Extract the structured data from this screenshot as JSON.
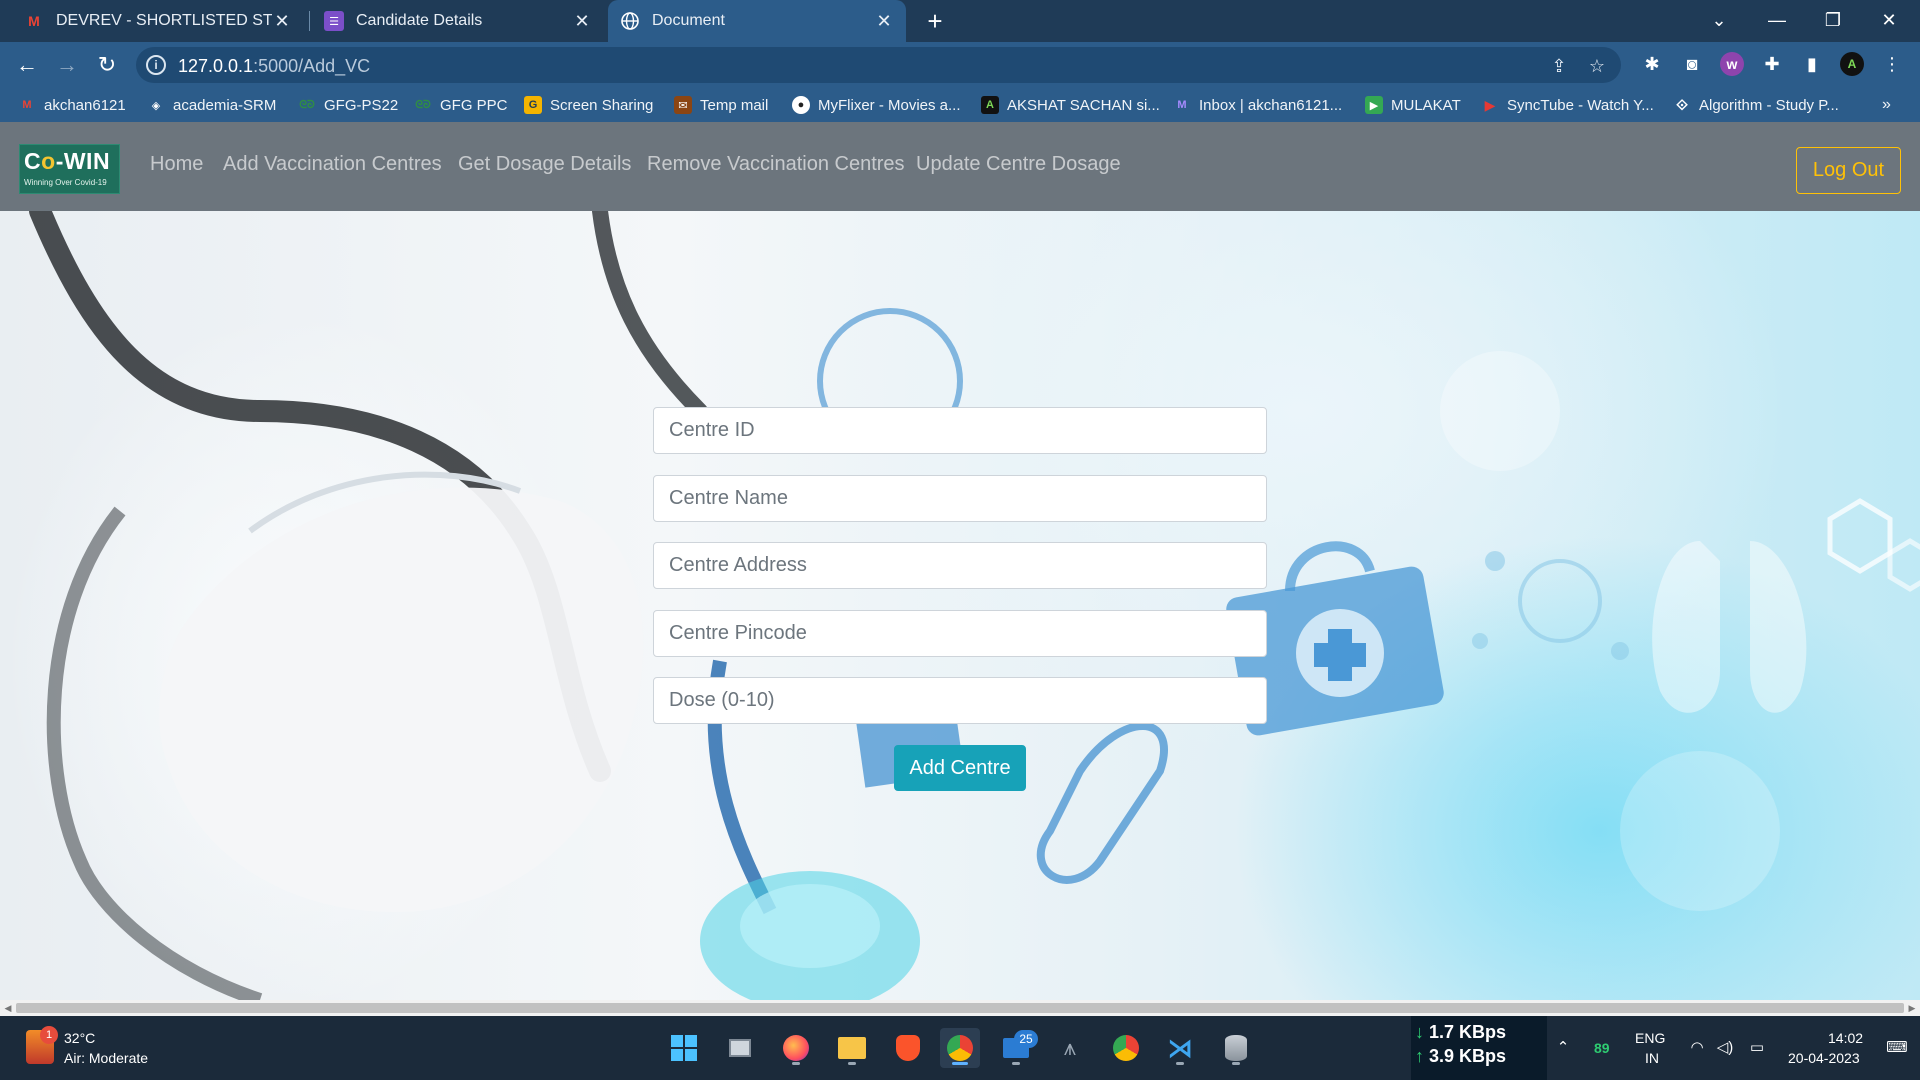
{
  "browser": {
    "tabs": [
      {
        "title": "DEVREV - SHORTLISTED STUDEN",
        "icon": "gmail-icon",
        "active": false
      },
      {
        "title": "Candidate Details",
        "icon": "forms-icon",
        "active": false
      },
      {
        "title": "Document",
        "icon": "globe-icon",
        "active": true
      }
    ],
    "url_host": "127.0.0.1",
    "url_path": ":5000/Add_VC",
    "bookmarks": [
      {
        "label": "akchan6121",
        "icon": "gmail-icon",
        "color": "#c5221f"
      },
      {
        "label": "academia-SRM",
        "icon": "diamond-icon",
        "color": "#ffffff"
      },
      {
        "label": "GFG-PS22",
        "icon": "gfg-icon",
        "color": "#2f8d46"
      },
      {
        "label": "GFG PPC",
        "icon": "gfg-icon",
        "color": "#2f8d46"
      },
      {
        "label": "Screen Sharing",
        "icon": "screen-share-icon",
        "color": "#f4b400"
      },
      {
        "label": "Temp mail",
        "icon": "temp-mail-icon",
        "color": "#8b4513"
      },
      {
        "label": "MyFlixer - Movies a...",
        "icon": "film-reel-icon",
        "color": "#ffffff"
      },
      {
        "label": "AKSHAT SACHAN si...",
        "icon": "profile-icon",
        "color": "#111111"
      },
      {
        "label": "Inbox | akchan6121...",
        "icon": "proton-mail-icon",
        "color": "#6d4aff"
      },
      {
        "label": "MULAKAT",
        "icon": "meet-icon",
        "color": "#34a853"
      },
      {
        "label": "SyncTube - Watch Y...",
        "icon": "play-icon",
        "color": "#e53935"
      },
      {
        "label": "Algorithm - Study P...",
        "icon": "algorithm-icon",
        "color": "#dddddd"
      }
    ]
  },
  "navbar": {
    "brand_main": "Co-WIN",
    "brand_tagline": "Winning Over Covid-19",
    "links": [
      "Home",
      "Add Vaccination Centres",
      "Get Dosage Details",
      "Remove Vaccination Centres",
      "Update Centre Dosage"
    ],
    "logout_label": "Log Out"
  },
  "form": {
    "fields": [
      {
        "placeholder": "Centre ID",
        "value": ""
      },
      {
        "placeholder": "Centre Name",
        "value": ""
      },
      {
        "placeholder": "Centre Address",
        "value": ""
      },
      {
        "placeholder": "Centre Pincode",
        "value": ""
      },
      {
        "placeholder": "Dose (0-10)",
        "value": ""
      }
    ],
    "submit_label": "Add Centre"
  },
  "taskbar": {
    "temperature": "32°C",
    "air_quality": "Air: Moderate",
    "weather_badge": "1",
    "mail_badge": "25",
    "net_down": "1.7 KBps",
    "net_up": "3.9 KBps",
    "battery_level": "89",
    "language": "ENG",
    "region": "IN",
    "time": "14:02",
    "date": "20-04-2023"
  },
  "colors": {
    "navbar_bg": "#6c757d",
    "logout_outline": "#ffc107",
    "submit_bg": "#17a2b8",
    "browser_frame": "#2c5c8a"
  }
}
